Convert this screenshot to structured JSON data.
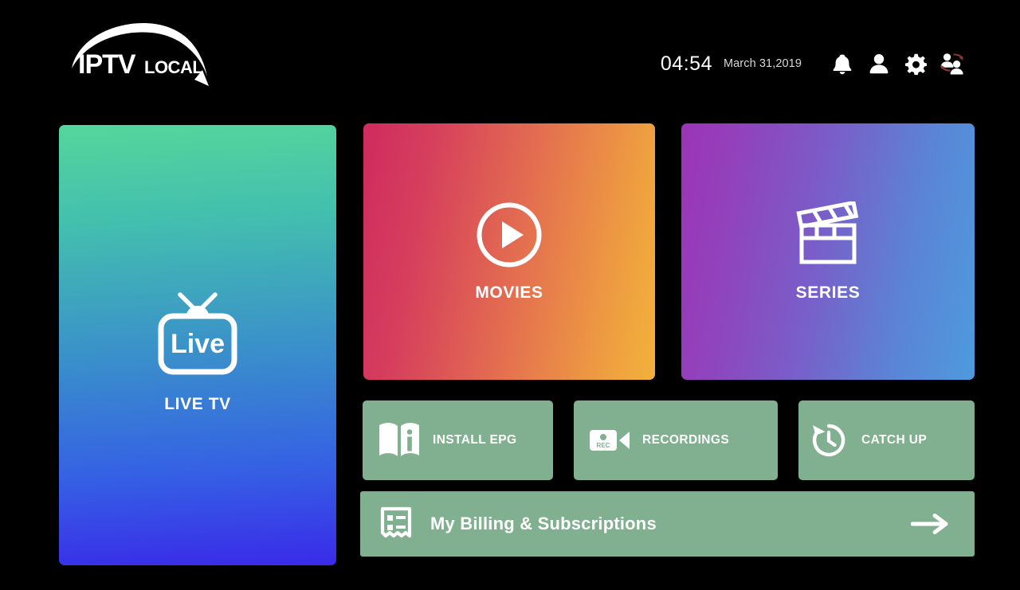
{
  "app": {
    "brand_primary": "IPTV",
    "brand_secondary": "LOCAL",
    "background_color": "#000000"
  },
  "header": {
    "time": "04:54",
    "date": "March 31,2019",
    "icons": [
      {
        "name": "notifications-icon",
        "label": "Notifications"
      },
      {
        "name": "profile-icon",
        "label": "Profile"
      },
      {
        "name": "settings-icon",
        "label": "Settings"
      },
      {
        "name": "switch-user-icon",
        "label": "Switch User"
      }
    ]
  },
  "cards": {
    "live_tv": {
      "label": "LIVE TV",
      "icon": "live-tv-icon",
      "icon_text": "Live",
      "gradient_from": "#55d69c",
      "gradient_to": "#3a2ae8"
    },
    "movies": {
      "label": "MOVIES",
      "icon": "play-circle-icon",
      "gradient_from": "#cf2b5f",
      "gradient_to": "#f3b13c"
    },
    "series": {
      "label": "SERIES",
      "icon": "clapperboard-icon",
      "gradient_from": "#9c34b8",
      "gradient_to": "#4e9ade"
    }
  },
  "actions": {
    "accent_color": "#80b08f",
    "install_epg": {
      "label": "INSTALL EPG",
      "icon": "book-info-icon"
    },
    "recordings": {
      "label": "RECORDINGS",
      "icon": "video-camera-rec-icon",
      "icon_text": "REC"
    },
    "catch_up": {
      "label": "CATCH UP",
      "icon": "history-clock-icon"
    }
  },
  "billing": {
    "label": "My Billing & Subscriptions",
    "icon": "invoice-icon",
    "arrow_icon": "arrow-right-icon"
  }
}
